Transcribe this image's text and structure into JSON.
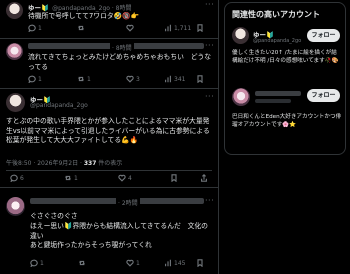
{
  "tweet_top": {
    "name": "ゆー🔰",
    "handle": "@pandapanda_2go · 8時間",
    "text": "待機所で号呼してて7ワロタ🤣🔞👉",
    "stats": {
      "replies": "1",
      "views": "1,711"
    }
  },
  "reply_1": {
    "time": "· 8時間",
    "text": "流れてきてちょっとみたけどめちゃめちゃおもちい　どうなってる",
    "stats": {
      "replies": "1",
      "retweets": "1",
      "likes": "3",
      "views": "341"
    }
  },
  "main_tweet": {
    "name": "ゆー🔰",
    "handle": "@pandapanda_2go",
    "text": "すとぷの中の歌い手界隈とかが参入したことによるママ米が大量発生vs以前ママ米によって引退したライバーがいる為に古参勢による松葉が発生して大大大ファイトしてる💪🔥",
    "meta_time": "午後8:50 · 2026年9月2日 ·",
    "meta_views_count": "337",
    "meta_views_label": "件の表示",
    "stats": {
      "replies": "6",
      "retweets": "1",
      "likes": "4"
    }
  },
  "reply_2": {
    "time": "· 2時間",
    "text_1": "ぐさぐさのぐさ",
    "text_2": "ほえー思い🔰界隈からも結構流入してきてるんだ　文化の違い",
    "text_3": "あと鍵垢作ったからそっち覗がってくれ",
    "stats": {
      "replies": "1",
      "likes": "1",
      "views": "145"
    }
  },
  "sidebar": {
    "title": "関連性の高いアカウント",
    "account_1": {
      "name": "ゆー🔰",
      "handle": "@pandapanda_2go",
      "follow_label": "フォロー",
      "bio": "優しく生きたい20↑ /たまに絵を描くが結構絵だけ不明 /日々の感想呟いてます🥀🎨"
    },
    "account_2": {
      "bio": "巴日和くんとEden大好きアカウントかつ俳瑠オアカウントです🌸⭐",
      "follow_label": "フォロー"
    }
  },
  "colors": {
    "background": "#000000",
    "accent": "#1d9bf0",
    "text": "#e7e9ea",
    "muted": "#71767b"
  }
}
